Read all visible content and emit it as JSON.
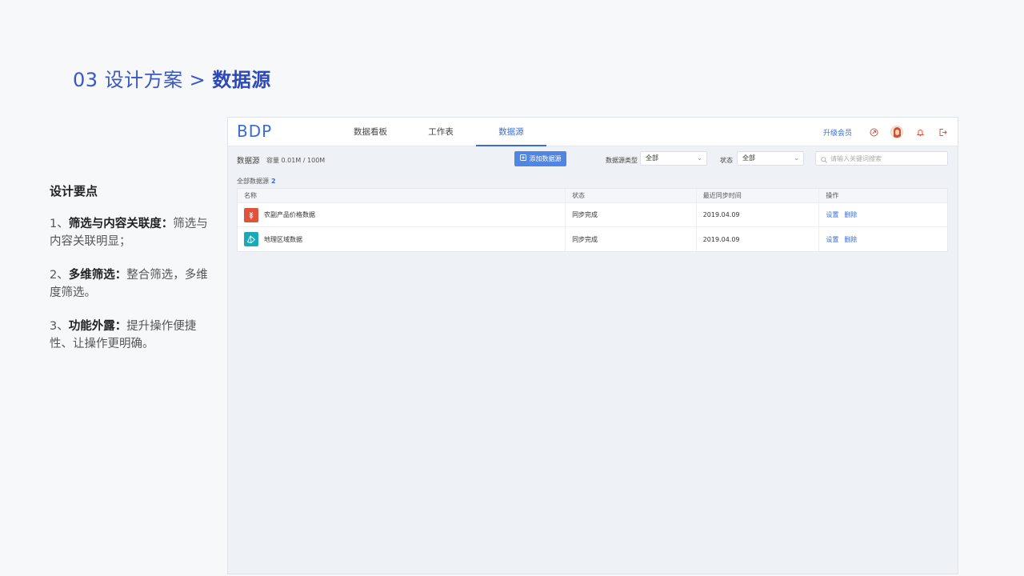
{
  "slide": {
    "title_prefix": "03 设计方案",
    "title_sep": ">",
    "title_current": "数据源"
  },
  "notes": {
    "heading": "设计要点",
    "items": [
      {
        "num": "1、",
        "bold": "筛选与内容关联度：",
        "text": "筛选与内容关联明显；"
      },
      {
        "num": "2、",
        "bold": "多维筛选：",
        "text": "整合筛选，多维度筛选。"
      },
      {
        "num": "3、",
        "bold": "功能外露：",
        "text": "提升操作便捷性、让操作更明确。"
      }
    ]
  },
  "app": {
    "logo": "BDP",
    "nav": [
      "数据看板",
      "工作表",
      "数据源"
    ],
    "active_nav": 2,
    "upgrade": "升级会员",
    "accent": "#3a6bd6",
    "icons": [
      "share-icon",
      "avatar",
      "bell-icon",
      "logout-icon"
    ]
  },
  "toolbar": {
    "label": "数据源",
    "capacity": "容量 0.01M / 100M",
    "add_button": "添加数据源",
    "type_label": "数据源类型",
    "type_value": "全部",
    "status_label": "状态",
    "status_value": "全部",
    "search_placeholder": "请输入关键词搜索"
  },
  "summary": {
    "label": "全部数据源",
    "count": "2"
  },
  "table": {
    "headers": [
      "名称",
      "状态",
      "最近同步时间",
      "操作"
    ],
    "rows": [
      {
        "name": "农副产品价格数据",
        "icon_color": "#e0523c",
        "status": "同步完成",
        "time": "2019.04.09",
        "action1": "设置",
        "action2": "删除"
      },
      {
        "name": "地理区域数据",
        "icon_color": "#1ba8b8",
        "status": "同步完成",
        "time": "2019.04.09",
        "action1": "设置",
        "action2": "删除"
      }
    ]
  }
}
